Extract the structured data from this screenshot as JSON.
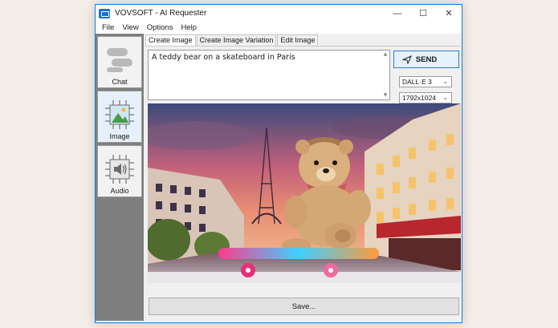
{
  "window": {
    "title": "VOVSOFT - AI Requester",
    "controls": {
      "minimize": "—",
      "maximize": "☐",
      "close": "✕"
    }
  },
  "menu": [
    "File",
    "View",
    "Options",
    "Help"
  ],
  "sidebar": {
    "items": [
      {
        "label": "Chat",
        "icon": "chat-bubbles-icon"
      },
      {
        "label": "Image",
        "icon": "image-chip-icon",
        "active": true
      },
      {
        "label": "Audio",
        "icon": "speaker-chip-icon"
      }
    ]
  },
  "tabs": [
    {
      "label": "Create Image",
      "active": true
    },
    {
      "label": "Create Image Variation"
    },
    {
      "label": "Edit Image"
    }
  ],
  "prompt": {
    "value": "A teddy bear on a skateboard in Paris"
  },
  "send": {
    "label": "SEND",
    "icon": "send-icon"
  },
  "model_select": {
    "value": "DALL·E 3"
  },
  "size_select": {
    "value": "1792x1024"
  },
  "result_image": {
    "description_icon": "generated-image"
  },
  "save": {
    "label": "Save..."
  },
  "colors": {
    "accent": "#2a7bd3",
    "sidebar": "#7f7f7f"
  }
}
